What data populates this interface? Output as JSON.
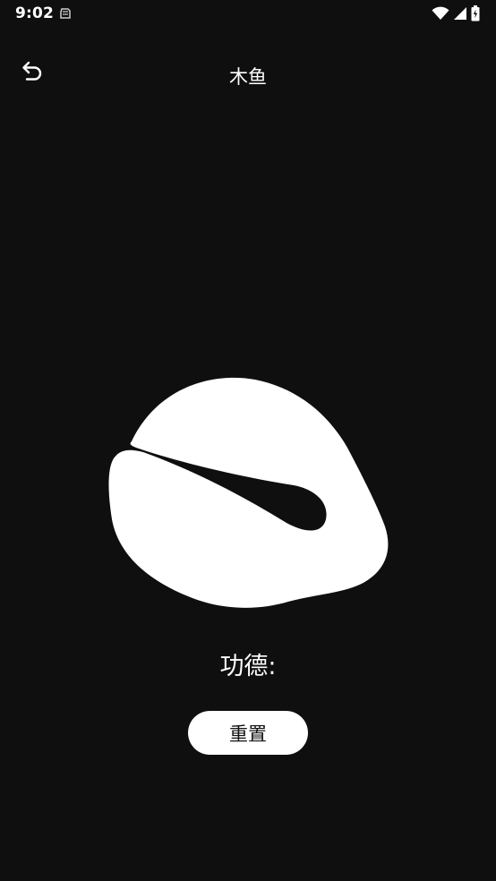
{
  "status_bar": {
    "time": "9:02",
    "icons": [
      "notification-icon",
      "wifi-icon",
      "cellular-signal-icon",
      "battery-icon"
    ]
  },
  "app_bar": {
    "back_icon": "undo-arrow-icon",
    "title": "木鱼"
  },
  "muyu": {
    "icon": "wooden-fish-icon",
    "color": "#ffffff"
  },
  "merit": {
    "label": "功德:"
  },
  "reset": {
    "label": "重置"
  },
  "colors": {
    "background": "#0f0f0f",
    "foreground": "#ffffff",
    "button_text": "#111111"
  }
}
